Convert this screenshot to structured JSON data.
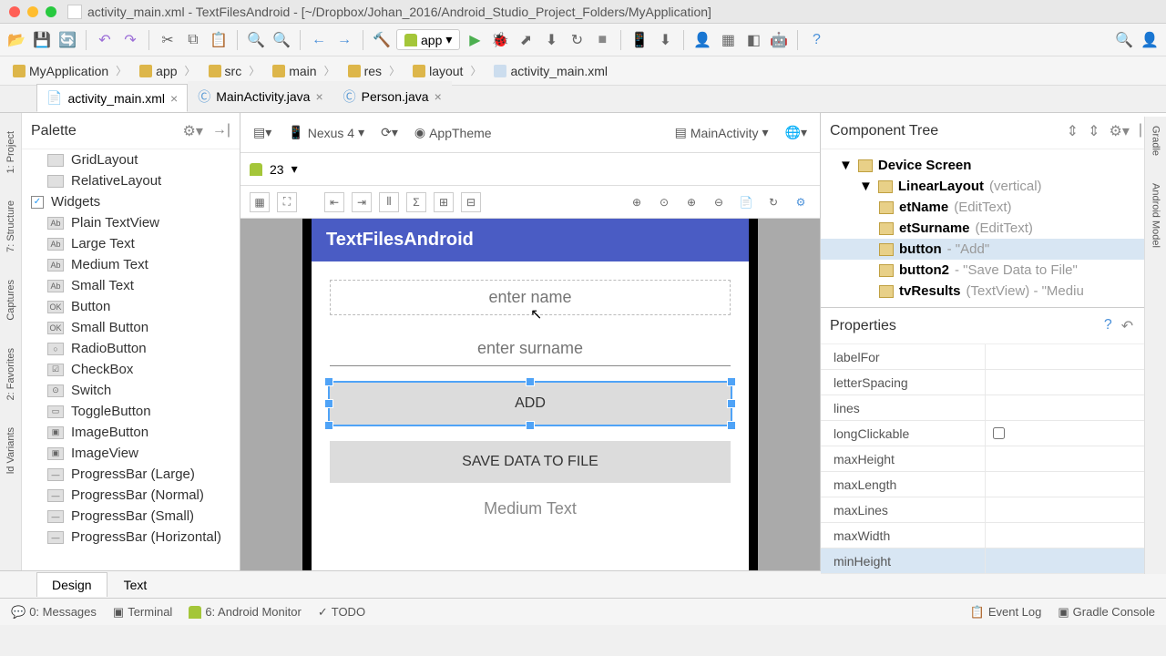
{
  "title": "activity_main.xml - TextFilesAndroid - [~/Dropbox/Johan_2016/Android_Studio_Project_Folders/MyApplication]",
  "run_config": "app",
  "breadcrumb": [
    "MyApplication",
    "app",
    "src",
    "main",
    "res",
    "layout",
    "activity_main.xml"
  ],
  "tabs": [
    {
      "label": "activity_main.xml",
      "active": true
    },
    {
      "label": "MainActivity.java",
      "active": false
    },
    {
      "label": "Person.java",
      "active": false
    }
  ],
  "left_rails": [
    "1: Project",
    "7: Structure",
    "Captures",
    "2: Favorites",
    "ld Variants"
  ],
  "right_rails": [
    "Gradle",
    "Android Model"
  ],
  "palette": {
    "title": "Palette",
    "items": [
      {
        "label": "GridLayout",
        "type": "layout"
      },
      {
        "label": "RelativeLayout",
        "type": "layout"
      },
      {
        "label": "Widgets",
        "type": "category",
        "checked": true
      },
      {
        "label": "Plain TextView",
        "type": "widget",
        "tag": "Ab"
      },
      {
        "label": "Large Text",
        "type": "widget",
        "tag": "Ab"
      },
      {
        "label": "Medium Text",
        "type": "widget",
        "tag": "Ab"
      },
      {
        "label": "Small Text",
        "type": "widget",
        "tag": "Ab"
      },
      {
        "label": "Button",
        "type": "widget",
        "tag": "OK"
      },
      {
        "label": "Small Button",
        "type": "widget",
        "tag": "OK"
      },
      {
        "label": "RadioButton",
        "type": "widget",
        "tag": "○"
      },
      {
        "label": "CheckBox",
        "type": "widget",
        "tag": "☑"
      },
      {
        "label": "Switch",
        "type": "widget",
        "tag": "⊙"
      },
      {
        "label": "ToggleButton",
        "type": "widget",
        "tag": "▭"
      },
      {
        "label": "ImageButton",
        "type": "widget",
        "tag": "▣"
      },
      {
        "label": "ImageView",
        "type": "widget",
        "tag": "▣"
      },
      {
        "label": "ProgressBar (Large)",
        "type": "widget",
        "tag": "—"
      },
      {
        "label": "ProgressBar (Normal)",
        "type": "widget",
        "tag": "—"
      },
      {
        "label": "ProgressBar (Small)",
        "type": "widget",
        "tag": "—"
      },
      {
        "label": "ProgressBar (Horizontal)",
        "type": "widget",
        "tag": "—"
      }
    ]
  },
  "designer": {
    "device": "Nexus 4",
    "theme": "AppTheme",
    "activity": "MainActivity",
    "api": "23",
    "app_title": "TextFilesAndroid",
    "hint_name": "enter name",
    "hint_surname": "enter surname",
    "btn_add": "ADD",
    "btn_save": "SAVE DATA TO FILE",
    "medium_text": "Medium Text"
  },
  "tree": {
    "title": "Component Tree",
    "items": [
      {
        "indent": 0,
        "label": "Device Screen",
        "hint": "",
        "icon": "dev"
      },
      {
        "indent": 1,
        "label": "LinearLayout",
        "hint": "(vertical)",
        "icon": "ll"
      },
      {
        "indent": 2,
        "label": "etName",
        "hint": "(EditText)",
        "icon": "et"
      },
      {
        "indent": 2,
        "label": "etSurname",
        "hint": "(EditText)",
        "icon": "et"
      },
      {
        "indent": 2,
        "label": "button",
        "hint": "- \"Add\"",
        "icon": "btn",
        "selected": true
      },
      {
        "indent": 2,
        "label": "button2",
        "hint": "- \"Save Data to File\"",
        "icon": "btn"
      },
      {
        "indent": 2,
        "label": "tvResults",
        "hint": "(TextView) - \"Mediu",
        "icon": "tv"
      }
    ]
  },
  "properties": {
    "title": "Properties",
    "rows": [
      {
        "name": "labelFor",
        "val": ""
      },
      {
        "name": "letterSpacing",
        "val": ""
      },
      {
        "name": "lines",
        "val": ""
      },
      {
        "name": "longClickable",
        "val": "",
        "checkbox": true
      },
      {
        "name": "maxHeight",
        "val": ""
      },
      {
        "name": "maxLength",
        "val": ""
      },
      {
        "name": "maxLines",
        "val": ""
      },
      {
        "name": "maxWidth",
        "val": ""
      },
      {
        "name": "minHeight",
        "val": "",
        "selected": true
      }
    ]
  },
  "bottom_tabs": {
    "design": "Design",
    "text": "Text"
  },
  "status": {
    "messages": "0: Messages",
    "terminal": "Terminal",
    "monitor": "6: Android Monitor",
    "todo": "TODO",
    "event": "Event Log",
    "gradle": "Gradle Console"
  }
}
